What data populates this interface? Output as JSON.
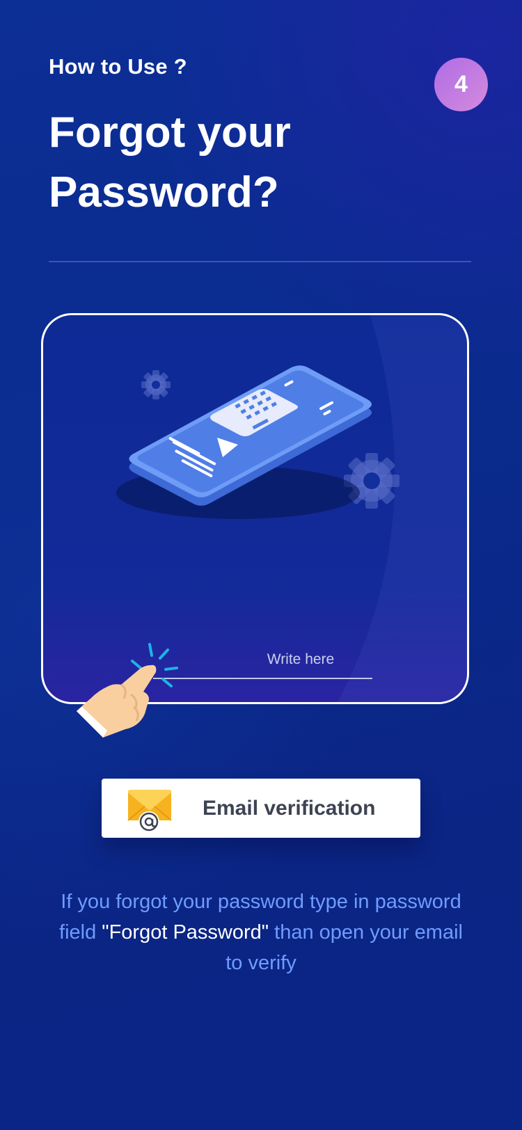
{
  "header": {
    "eyebrow": "How to Use ?",
    "step_number": "4",
    "title": "Forgot your Password?"
  },
  "illustration": {
    "input_hint": "Write here",
    "icons": [
      "phone-icon",
      "keyboard-icon",
      "gear-icon",
      "pointing-hand-icon"
    ]
  },
  "email_option": {
    "label": "Email verification",
    "icon": "email-at-icon"
  },
  "description": {
    "part1": "If you forgot your password type in password field ",
    "highlight": "\"Forgot Password\"",
    "part2": " than open your email to verify"
  },
  "colors": {
    "background": "#0a2a8c",
    "badge": "#c27ae2",
    "accent_text": "#6f9cff",
    "card_background": "#ffffff"
  }
}
